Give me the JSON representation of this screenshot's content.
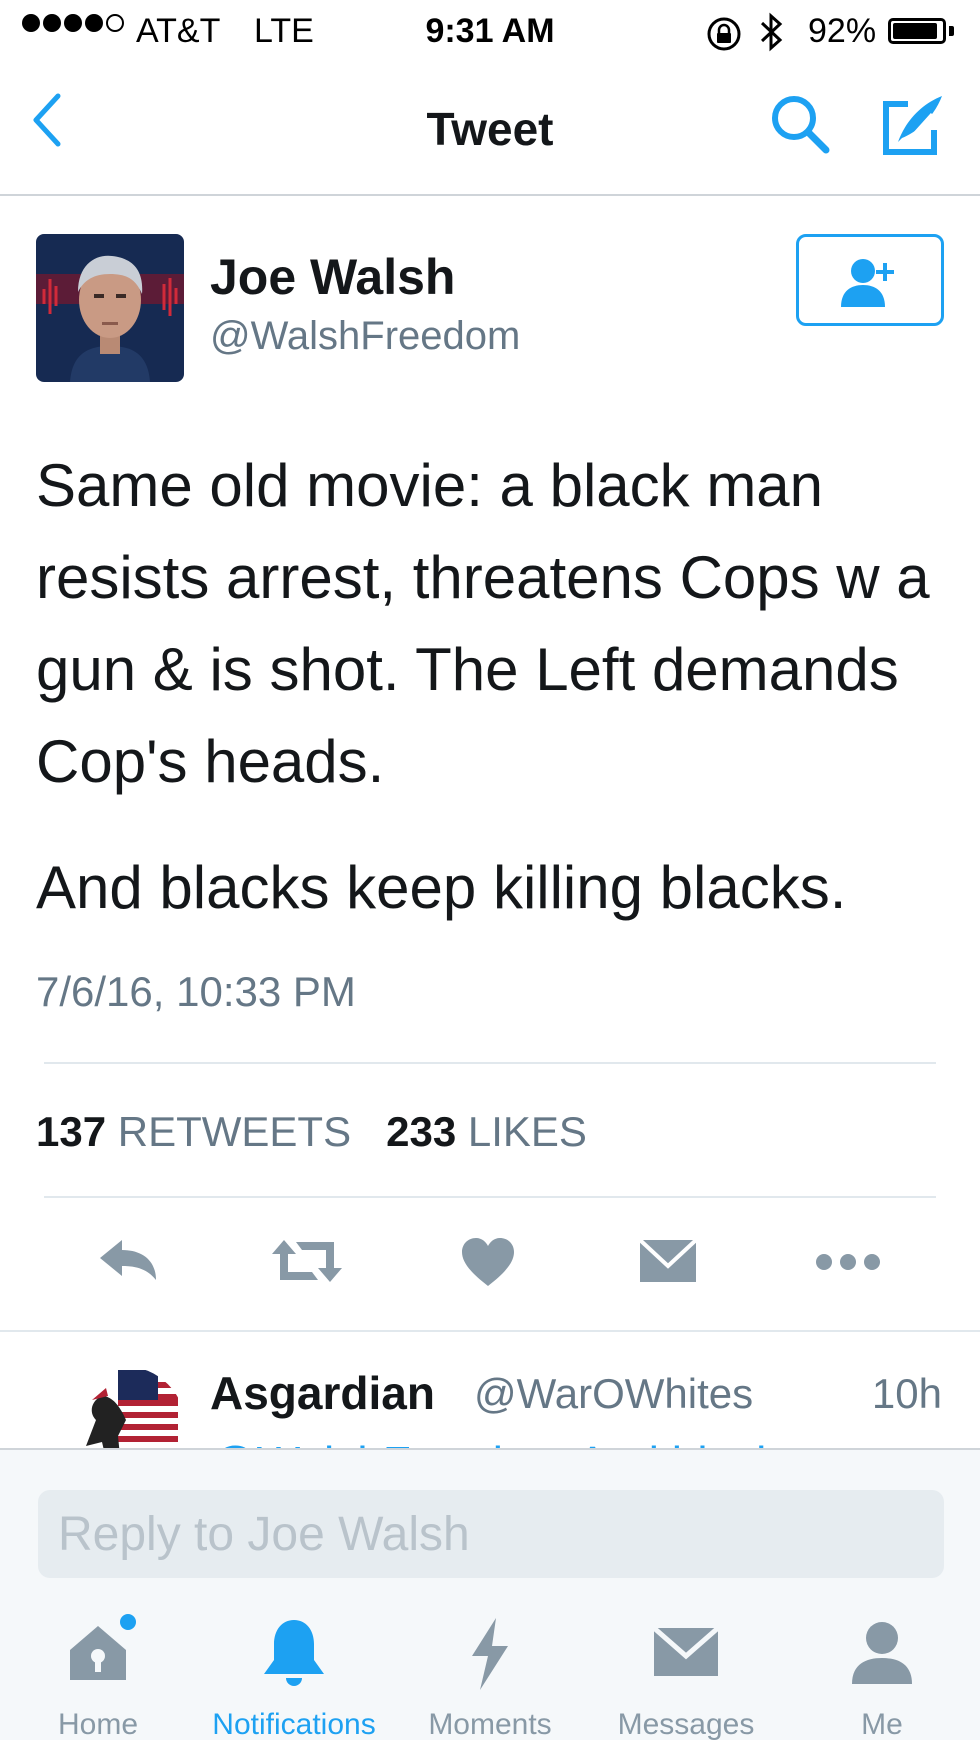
{
  "status_bar": {
    "carrier": "AT&T",
    "network": "LTE",
    "time": "9:31 AM",
    "battery": "92%",
    "battery_level": 0.92,
    "signal_bars": 4,
    "signal_total": 5
  },
  "nav": {
    "title": "Tweet",
    "back_icon": "chevron-left-icon",
    "search_icon": "search-icon",
    "compose_icon": "compose-icon"
  },
  "tweet": {
    "author_name": "Joe Walsh",
    "author_handle": "@WalshFreedom",
    "follow_icon": "add-user-icon",
    "text_p1": "Same old movie: a black man resists arrest, threatens Cops w a gun & is shot. The Left demands Cop's heads.",
    "text_p2": "And blacks keep killing blacks.",
    "timestamp": "7/6/16, 10:33 PM",
    "retweets_count": "137",
    "retweets_label": "RETWEETS",
    "likes_count": "233",
    "likes_label": "LIKES"
  },
  "actions": [
    {
      "name": "reply",
      "icon": "reply-icon"
    },
    {
      "name": "retweet",
      "icon": "retweet-icon"
    },
    {
      "name": "like",
      "icon": "heart-icon"
    },
    {
      "name": "dm",
      "icon": "envelope-icon"
    },
    {
      "name": "more",
      "icon": "more-icon"
    }
  ],
  "reply_preview": {
    "name": "Asgardian",
    "handle": "@WarOWhites",
    "time": "10h",
    "text": "@WalshFreedom And black"
  },
  "composer": {
    "placeholder": "Reply to Joe Walsh"
  },
  "tab_bar": [
    {
      "label": "Home",
      "icon": "home-icon",
      "active": false,
      "badge": true
    },
    {
      "label": "Notifications",
      "icon": "bell-icon",
      "active": true
    },
    {
      "label": "Moments",
      "icon": "lightning-icon",
      "active": false
    },
    {
      "label": "Messages",
      "icon": "envelope-icon",
      "active": false
    },
    {
      "label": "Me",
      "icon": "person-icon",
      "active": false
    }
  ],
  "colors": {
    "accent": "#1da1f2",
    "text": "#14171a",
    "secondary": "#657786",
    "inactive_icon": "#8899a6"
  }
}
